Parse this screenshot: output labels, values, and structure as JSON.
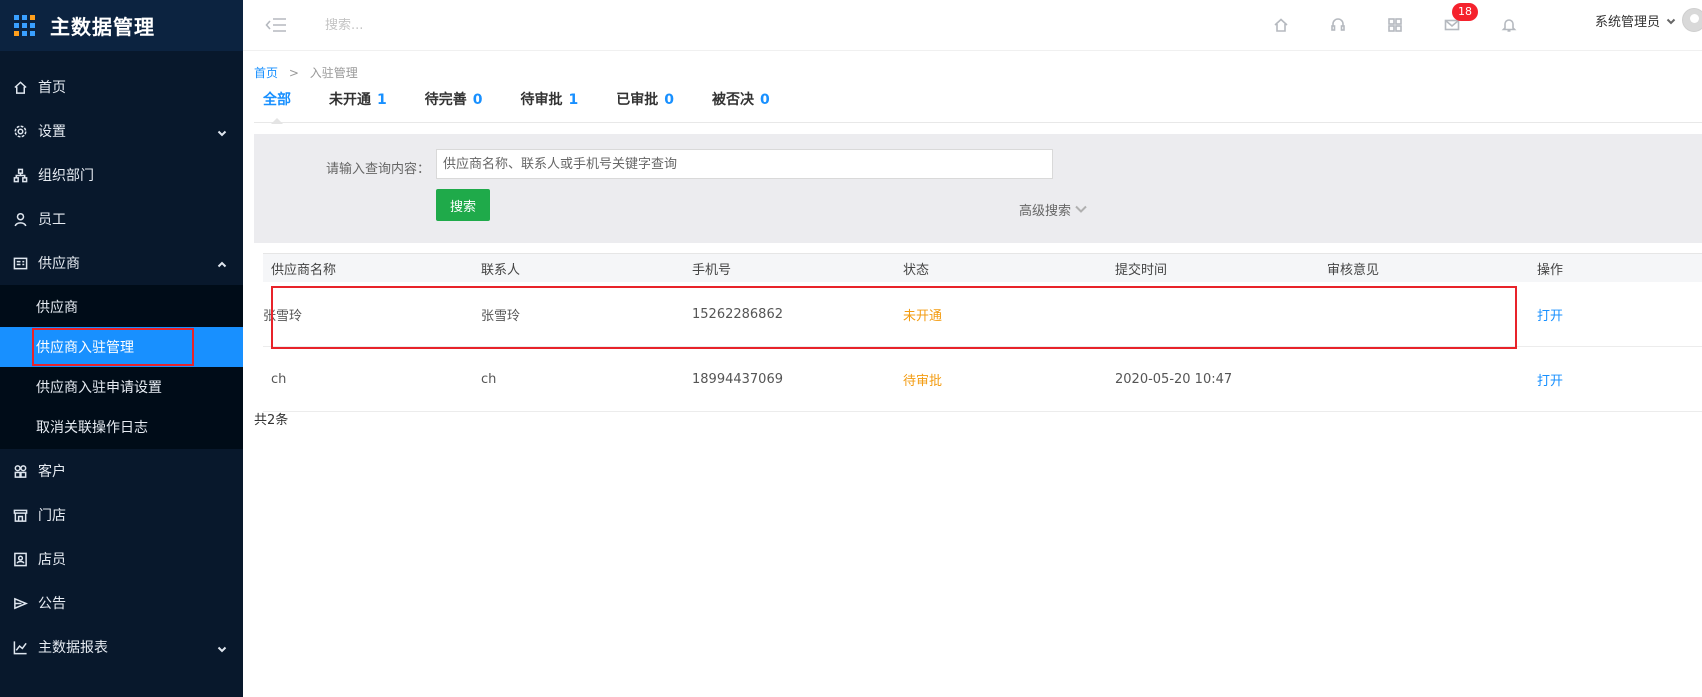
{
  "app": {
    "title": "主数据管理"
  },
  "colors": {
    "accent": "#1890ff",
    "sidebar_bg": "#08182c",
    "search_button": "#1faa4a",
    "status_orange": "#f39c12",
    "highlight_red": "#e8232a"
  },
  "sidebar": {
    "items": [
      {
        "label": "首页",
        "icon": "home-icon"
      },
      {
        "label": "设置",
        "icon": "gear-icon",
        "expandable": true
      },
      {
        "label": "组织部门",
        "icon": "org-chart-icon"
      },
      {
        "label": "员工",
        "icon": "user-icon"
      },
      {
        "label": "供应商",
        "icon": "supplier-icon",
        "expanded": true
      },
      {
        "label": "客户",
        "icon": "customers-icon"
      },
      {
        "label": "门店",
        "icon": "store-icon"
      },
      {
        "label": "店员",
        "icon": "clerk-icon"
      },
      {
        "label": "公告",
        "icon": "announcement-icon"
      },
      {
        "label": "主数据报表",
        "icon": "chart-icon",
        "expandable": true
      }
    ],
    "supplier_sub": [
      {
        "label": "供应商"
      },
      {
        "label": "供应商入驻管理",
        "active": true
      },
      {
        "label": "供应商入驻申请设置"
      },
      {
        "label": "取消关联操作日志"
      }
    ]
  },
  "topbar": {
    "search_placeholder": "搜索...",
    "icons": [
      "home-icon",
      "headset-icon",
      "grid-icon",
      "mail-icon",
      "bell-icon"
    ],
    "mail_badge": "18",
    "user_name": "系统管理员"
  },
  "breadcrumb": {
    "home": "首页",
    "separator": ">",
    "current": "入驻管理"
  },
  "tabs": [
    {
      "label": "全部",
      "count": ""
    },
    {
      "label": "未开通",
      "count": "1"
    },
    {
      "label": "待完善",
      "count": "0"
    },
    {
      "label": "待审批",
      "count": "1"
    },
    {
      "label": "已审批",
      "count": "0"
    },
    {
      "label": "被否决",
      "count": "0"
    }
  ],
  "filter": {
    "label": "请输入查询内容：",
    "placeholder": "供应商名称、联系人或手机号关键字查询",
    "value": "",
    "search_button": "搜索",
    "advanced": "高级搜索"
  },
  "table": {
    "columns": [
      "供应商名称",
      "联系人",
      "手机号",
      "状态",
      "提交时间",
      "审核意见",
      "操作"
    ],
    "rows": [
      {
        "name": "张雪玲",
        "contact": "张雪玲",
        "phone": "15262286862",
        "status": "未开通",
        "submitted": "",
        "review": "",
        "action": "打开"
      },
      {
        "name": "ch",
        "contact": "ch",
        "phone": "18994437069",
        "status": "待审批",
        "submitted": "2020-05-20 10:47",
        "review": "",
        "action": "打开"
      }
    ]
  },
  "total": "共2条"
}
